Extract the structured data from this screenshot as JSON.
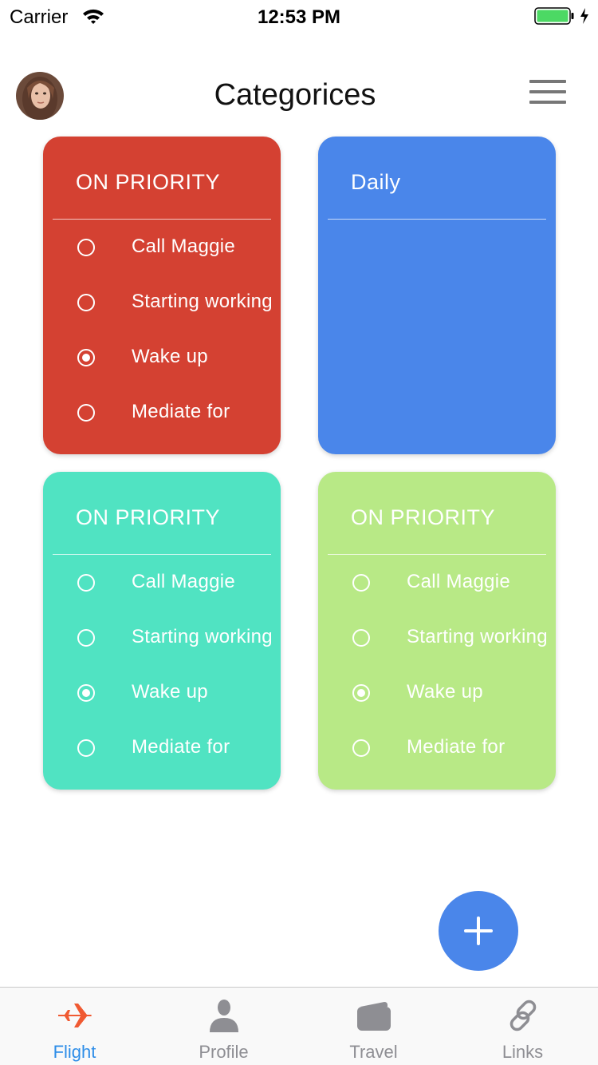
{
  "status_bar": {
    "carrier": "Carrier",
    "time": "12:53 PM",
    "battery_color": "#4cd964"
  },
  "header": {
    "title": "Categorices"
  },
  "colors": {
    "red_card": "#d44132",
    "blue_card": "#4a86ea",
    "teal_card": "#50e3c2",
    "green_card": "#b8e986",
    "fab": "#4a86ea",
    "tab_active": "#2d8de8",
    "tab_inactive": "#8e8e93",
    "flight_icon": "#f05a32"
  },
  "cards": [
    {
      "title": "ON PRIORITY",
      "tasks": [
        {
          "label": "Call Maggie",
          "checked": false
        },
        {
          "label": "Starting working",
          "checked": false
        },
        {
          "label": "Wake up",
          "checked": true
        },
        {
          "label": "Mediate for",
          "checked": false
        }
      ]
    },
    {
      "title": "Daily",
      "tasks": []
    },
    {
      "title": "ON PRIORITY",
      "tasks": [
        {
          "label": "Call Maggie",
          "checked": false
        },
        {
          "label": "Starting working",
          "checked": false
        },
        {
          "label": "Wake up",
          "checked": true
        },
        {
          "label": "Mediate for",
          "checked": false
        }
      ]
    },
    {
      "title": "ON PRIORITY",
      "tasks": [
        {
          "label": "Call Maggie",
          "checked": false
        },
        {
          "label": "Starting working",
          "checked": false
        },
        {
          "label": "Wake up",
          "checked": true
        },
        {
          "label": "Mediate for",
          "checked": false
        }
      ]
    }
  ],
  "fab": {
    "icon": "plus-icon"
  },
  "tabs": [
    {
      "label": "Flight",
      "icon": "airplane-icon",
      "active": true
    },
    {
      "label": "Profile",
      "icon": "person-icon",
      "active": false
    },
    {
      "label": "Travel",
      "icon": "wallet-icon",
      "active": false
    },
    {
      "label": "Links",
      "icon": "link-icon",
      "active": false
    }
  ]
}
